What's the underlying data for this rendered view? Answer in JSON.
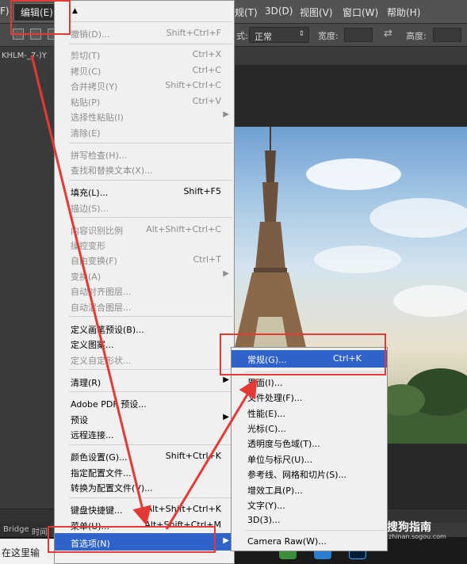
{
  "menubar": {
    "left_fragment": "F)",
    "edit_menu": "编辑(E)",
    "right_items": [
      "规(T)",
      "3D(D)",
      "视图(V)",
      "窗口(W)",
      "帮助(H)"
    ]
  },
  "options_bar": {
    "style_label": "式:",
    "style_value": "正常",
    "width_label": "宽度:",
    "height_label": "高度:"
  },
  "document_tab": "KHLM-_7-)Y",
  "bottom_tabs": [
    "Bridge",
    "时间"
  ],
  "taskbar": {
    "search_placeholder": "在这里输"
  },
  "watermark": {
    "name": "搜狗指南",
    "url": "zhinan.sogou.com"
  },
  "edit_menu": {
    "scroll_glyph": "▲",
    "items": [
      {
        "label": "撤销(D)...",
        "shortcut": "Shift+Ctrl+F"
      },
      {
        "label": "剪切(T)",
        "shortcut": "Ctrl+X"
      },
      {
        "label": "拷贝(C)",
        "shortcut": "Ctrl+C"
      },
      {
        "label": "合并拷贝(Y)",
        "shortcut": "Shift+Ctrl+C"
      },
      {
        "label": "粘贴(P)",
        "shortcut": "Ctrl+V"
      },
      {
        "label": "选择性粘贴(I)",
        "shortcut": ""
      },
      {
        "label": "清除(E)",
        "shortcut": ""
      },
      {
        "label": "拼写检查(H)...",
        "shortcut": ""
      },
      {
        "label": "查找和替换文本(X)...",
        "shortcut": ""
      },
      {
        "label": "填充(L)...",
        "shortcut": "Shift+F5"
      },
      {
        "label": "描边(S)...",
        "shortcut": ""
      },
      {
        "label": "内容识别比例",
        "shortcut": "Alt+Shift+Ctrl+C"
      },
      {
        "label": "操控变形",
        "shortcut": ""
      },
      {
        "label": "自由变换(F)",
        "shortcut": "Ctrl+T"
      },
      {
        "label": "变换(A)",
        "shortcut": ""
      },
      {
        "label": "自动对齐图层...",
        "shortcut": ""
      },
      {
        "label": "自动混合图层...",
        "shortcut": ""
      },
      {
        "label": "定义画笔预设(B)...",
        "shortcut": ""
      },
      {
        "label": "定义图案...",
        "shortcut": ""
      },
      {
        "label": "定义自定形状...",
        "shortcut": ""
      },
      {
        "label": "清理(R)",
        "shortcut": ""
      },
      {
        "label": "Adobe PDF 预设...",
        "shortcut": ""
      },
      {
        "label": "预设",
        "shortcut": ""
      },
      {
        "label": "远程连接...",
        "shortcut": ""
      },
      {
        "label": "颜色设置(G)...",
        "shortcut": "Shift+Ctrl+K"
      },
      {
        "label": "指定配置文件...",
        "shortcut": ""
      },
      {
        "label": "转换为配置文件(V)...",
        "shortcut": ""
      },
      {
        "label": "键盘快捷键...",
        "shortcut": "Alt+Shift+Ctrl+K"
      },
      {
        "label": "菜单(U)...",
        "shortcut": "Alt+Shift+Ctrl+M"
      },
      {
        "label": "首选项(N)",
        "shortcut": ""
      }
    ]
  },
  "preferences_submenu": {
    "items": [
      {
        "label": "常规(G)...",
        "shortcut": "Ctrl+K"
      },
      {
        "label": "界面(I)...",
        "shortcut": ""
      },
      {
        "label": "文件处理(F)...",
        "shortcut": ""
      },
      {
        "label": "性能(E)...",
        "shortcut": ""
      },
      {
        "label": "光标(C)...",
        "shortcut": ""
      },
      {
        "label": "透明度与色域(T)...",
        "shortcut": ""
      },
      {
        "label": "单位与标尺(U)...",
        "shortcut": ""
      },
      {
        "label": "参考线、网格和切片(S)...",
        "shortcut": ""
      },
      {
        "label": "增效工具(P)...",
        "shortcut": ""
      },
      {
        "label": "文字(Y)...",
        "shortcut": ""
      },
      {
        "label": "3D(3)...",
        "shortcut": ""
      },
      {
        "label": "Camera Raw(W)...",
        "shortcut": ""
      }
    ]
  },
  "colors": {
    "highlight": "#2f63c9",
    "annotation_red": "#e53935"
  }
}
